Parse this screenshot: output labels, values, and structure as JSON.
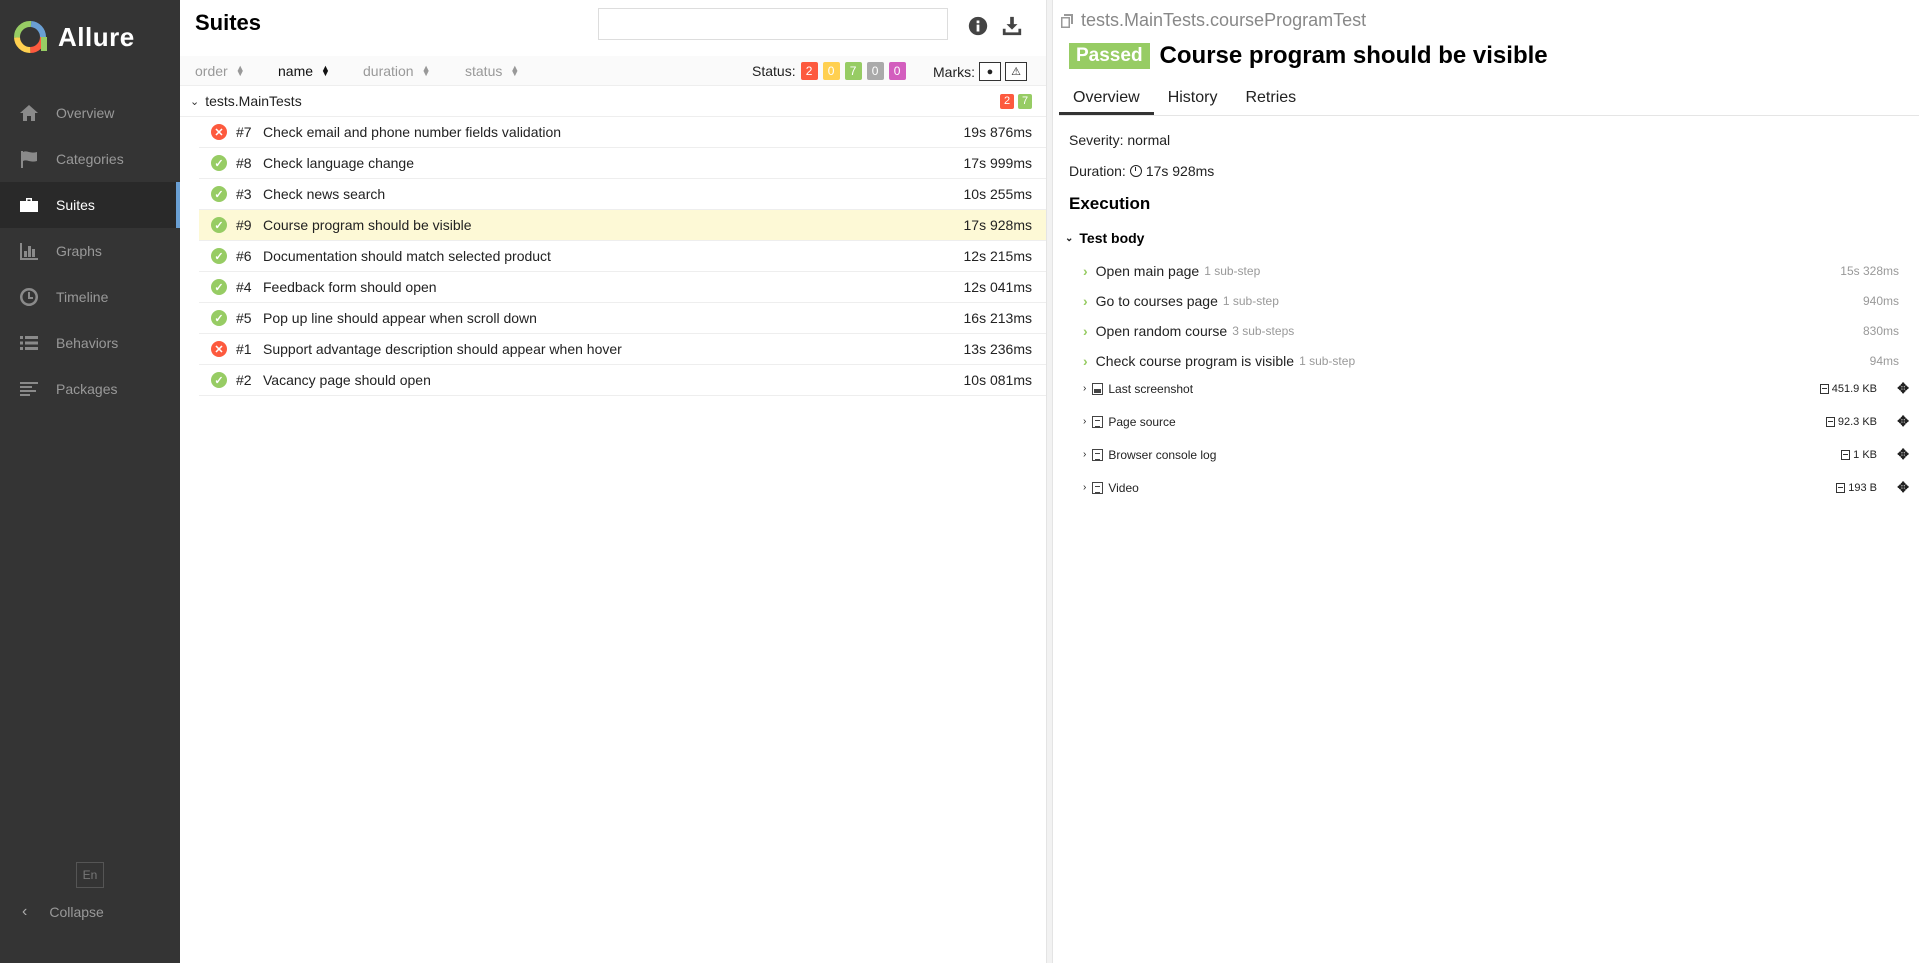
{
  "app": {
    "name": "Allure"
  },
  "sidebar": {
    "items": [
      {
        "label": "Overview",
        "icon": "home-icon"
      },
      {
        "label": "Categories",
        "icon": "flag-icon"
      },
      {
        "label": "Suites",
        "icon": "briefcase-icon",
        "active": true
      },
      {
        "label": "Graphs",
        "icon": "bar-chart-icon"
      },
      {
        "label": "Timeline",
        "icon": "clock-icon"
      },
      {
        "label": "Behaviors",
        "icon": "list-icon"
      },
      {
        "label": "Packages",
        "icon": "align-left-icon"
      }
    ],
    "language": "En",
    "collapse": "Collapse"
  },
  "suites": {
    "title": "Suites",
    "search": {
      "value": "",
      "placeholder": ""
    },
    "sort": {
      "order": "order",
      "name": "name",
      "duration": "duration",
      "status": "status"
    },
    "status_label": "Status:",
    "status_counts": [
      {
        "value": "2",
        "color": "#fd5a3e"
      },
      {
        "value": "0",
        "color": "#ffd050"
      },
      {
        "value": "7",
        "color": "#97cc64"
      },
      {
        "value": "0",
        "color": "#aaaaaa"
      },
      {
        "value": "0",
        "color": "#d35ebe"
      }
    ],
    "marks_label": "Marks:",
    "group": {
      "name": "tests.MainTests",
      "failed": "2",
      "passed": "7"
    },
    "tests": [
      {
        "num": "#7",
        "name": "Check email and phone number fields validation",
        "duration": "19s 876ms",
        "status": "failed"
      },
      {
        "num": "#8",
        "name": "Check language change",
        "duration": "17s 999ms",
        "status": "passed"
      },
      {
        "num": "#3",
        "name": "Check news search",
        "duration": "10s 255ms",
        "status": "passed"
      },
      {
        "num": "#9",
        "name": "Course program should be visible",
        "duration": "17s 928ms",
        "status": "passed",
        "selected": true
      },
      {
        "num": "#6",
        "name": "Documentation should match selected product",
        "duration": "12s 215ms",
        "status": "passed"
      },
      {
        "num": "#4",
        "name": "Feedback form should open",
        "duration": "12s 041ms",
        "status": "passed"
      },
      {
        "num": "#5",
        "name": "Pop up line should appear when scroll down",
        "duration": "16s 213ms",
        "status": "passed"
      },
      {
        "num": "#1",
        "name": "Support advantage description should appear when hover",
        "duration": "13s 236ms",
        "status": "failed"
      },
      {
        "num": "#2",
        "name": "Vacancy page should open",
        "duration": "10s 081ms",
        "status": "passed"
      }
    ]
  },
  "detail": {
    "full_name": "tests.MainTests.courseProgramTest",
    "status_label": "Passed",
    "title": "Course program should be visible",
    "tabs": [
      "Overview",
      "History",
      "Retries"
    ],
    "severity": "Severity: normal",
    "duration_label": "Duration:",
    "duration_value": "17s 928ms",
    "execution_title": "Execution",
    "test_body": "Test body",
    "steps": [
      {
        "name": "Open main page",
        "sub": "1 sub-step",
        "duration": "15s 328ms"
      },
      {
        "name": "Go to courses page",
        "sub": "1 sub-step",
        "duration": "940ms"
      },
      {
        "name": "Open random course",
        "sub": "3 sub-steps",
        "duration": "830ms"
      },
      {
        "name": "Check course program is visible",
        "sub": "1 sub-step",
        "duration": "94ms"
      }
    ],
    "attachments": [
      {
        "name": "Last screenshot",
        "size": "451.9 KB",
        "type": "image"
      },
      {
        "name": "Page source",
        "size": "92.3 KB",
        "type": "text"
      },
      {
        "name": "Browser console log",
        "size": "1 KB",
        "type": "text"
      },
      {
        "name": "Video",
        "size": "193 B",
        "type": "text"
      }
    ]
  },
  "colors": {
    "passed": "#97cc64",
    "failed": "#fd5a3e",
    "sidebar_bg": "#343434",
    "selected_row": "#fdf9d6"
  }
}
